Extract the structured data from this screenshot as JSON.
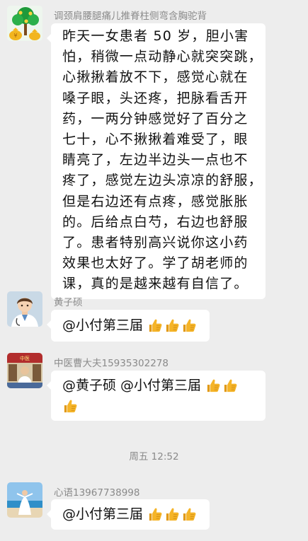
{
  "messages": [
    {
      "sender": "调颈肩腰腿痛儿推脊柱侧弯含胸驼背",
      "avatar_icon": "money-bag-tree-avatar",
      "lines": [
        "昨天一女患者 50 岁，胆小害",
        "怕，稍微一点动静心就突突跳，",
        "心揪揪着放不下，感觉心就在",
        "嗓子眼，头还疼，把脉看舌开",
        "药，一两分钟感觉好了百分之",
        "七十，心不揪揪着难受了，眼",
        "睛亮了，左边半边头一点也不",
        "疼了，感觉左边头凉凉的舒服，",
        "但是右边还有点疼，感觉胀胀",
        "的。后给点白芍，右边也舒服",
        "了。患者特别高兴说你这小药",
        "效果也太好了。学了胡老师的",
        "课，真的是越来越有自信了。"
      ]
    },
    {
      "sender": "黄子硕",
      "avatar_icon": "doctor-avatar",
      "text": "@小付第三届",
      "thumbs_icon": "thumbs-up-emoji",
      "thumbs_count": 3
    },
    {
      "sender": "中医曹大夫15935302278",
      "avatar_icon": "clinic-photo-avatar",
      "line1": "@黄子硕 @小付第三届",
      "thumbs_icon": "thumbs-up-emoji",
      "thumbs_line1_count": 2,
      "thumbs_line2_count": 1
    },
    {
      "sender": "心语13967738998",
      "avatar_icon": "beach-photo-avatar",
      "text": "@小付第三届",
      "thumbs_icon": "thumbs-up-emoji",
      "thumbs_count": 3
    }
  ],
  "timestamp": "周五 12:52",
  "colors": {
    "background": "#ededed",
    "bubble": "#ffffff",
    "sender_name": "#8a8a8a",
    "thumbs_up": "#f5b428"
  }
}
